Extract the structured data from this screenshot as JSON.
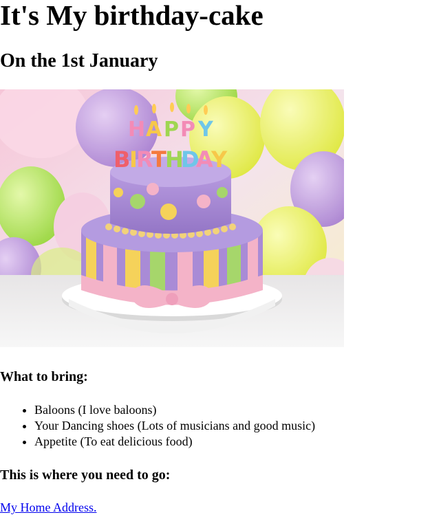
{
  "page": {
    "title": "It's My birthday-cake",
    "subtitle": "On the 1st January"
  },
  "image": {
    "alt": "birthday cake icon",
    "candle_letters": "HAPPY BIRTHDAY",
    "colors": {
      "background_pink": "#f6c6d8",
      "balloon_yellow": "#e8f04a",
      "balloon_purple": "#b78ad8",
      "balloon_green": "#a9e44e",
      "cake_purple": "#a989d4",
      "ribbon_pink": "#f4b3c8",
      "stripe_yellow": "#f5d25a",
      "stripe_green": "#a6d66b",
      "plate": "#f2f2f2"
    }
  },
  "bring": {
    "heading": "What to bring:",
    "items": [
      "Baloons (I love baloons)",
      "Your Dancing shoes (Lots of musicians and good music)",
      "Appetite (To eat delicious food)"
    ]
  },
  "directions": {
    "heading": "This is where you need to go:",
    "link_text": "My Home Address."
  }
}
